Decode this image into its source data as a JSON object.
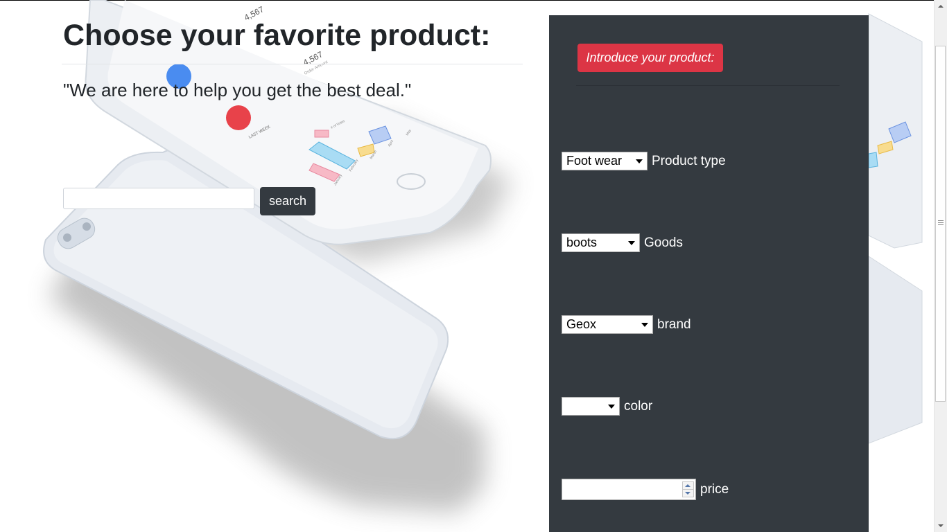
{
  "page": {
    "heading": "Choose your favorite product:",
    "tagline": "\"We are here to help you get the best deal.\""
  },
  "search": {
    "value": "",
    "button_label": "search"
  },
  "panel": {
    "intro_button_label": "Introduce your product:",
    "fields": {
      "product_type": {
        "selected": "Foot wear",
        "label": "Product type"
      },
      "goods": {
        "selected": "boots",
        "label": "Goods"
      },
      "brand": {
        "selected": "Geox",
        "label": "brand"
      },
      "color": {
        "selected": "",
        "label": "color"
      },
      "price": {
        "value": "",
        "label": "price"
      }
    }
  },
  "phone_art": {
    "stat_1": "4,567",
    "stat_2": "4,567",
    "stat_2_caption": "Order Amount",
    "card_caption": "LAST WEEK",
    "chart_legend": "# of Votes",
    "chart_months": [
      "January",
      "February",
      "March",
      "April",
      "May"
    ]
  },
  "colors": {
    "panel_bg": "#343a40",
    "intro_button_bg": "#dc3545",
    "search_button_bg": "#343a40",
    "heading_text": "#212529"
  },
  "icons": {
    "select_arrow": "chevron-down-icon",
    "spinner_up": "spin-up-icon",
    "spinner_down": "spin-down-icon"
  }
}
